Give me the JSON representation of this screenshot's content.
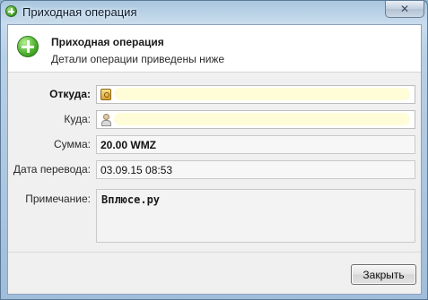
{
  "window": {
    "title": "Приходная операция",
    "close_glyph": "✕",
    "icon": "plus-circle-icon"
  },
  "header": {
    "title": "Приходная операция",
    "subtitle": "Детали операции приведены ниже",
    "icon": "plus-circle-icon"
  },
  "form": {
    "from": {
      "label": "Откуда:",
      "value": "",
      "icon": "purse-icon"
    },
    "to": {
      "label": "Куда:",
      "value": "",
      "icon": "user-icon"
    },
    "amount": {
      "label": "Сумма:",
      "value": "20.00 WMZ"
    },
    "date": {
      "label": "Дата перевода:",
      "value": "03.09.15 08:53"
    },
    "note": {
      "label": "Примечание:",
      "value": "Вплюсе.ру"
    }
  },
  "footer": {
    "close_label": "Закрыть"
  },
  "colors": {
    "accent_green": "#4aae2c",
    "redaction_yellow": "#fffdd6"
  }
}
